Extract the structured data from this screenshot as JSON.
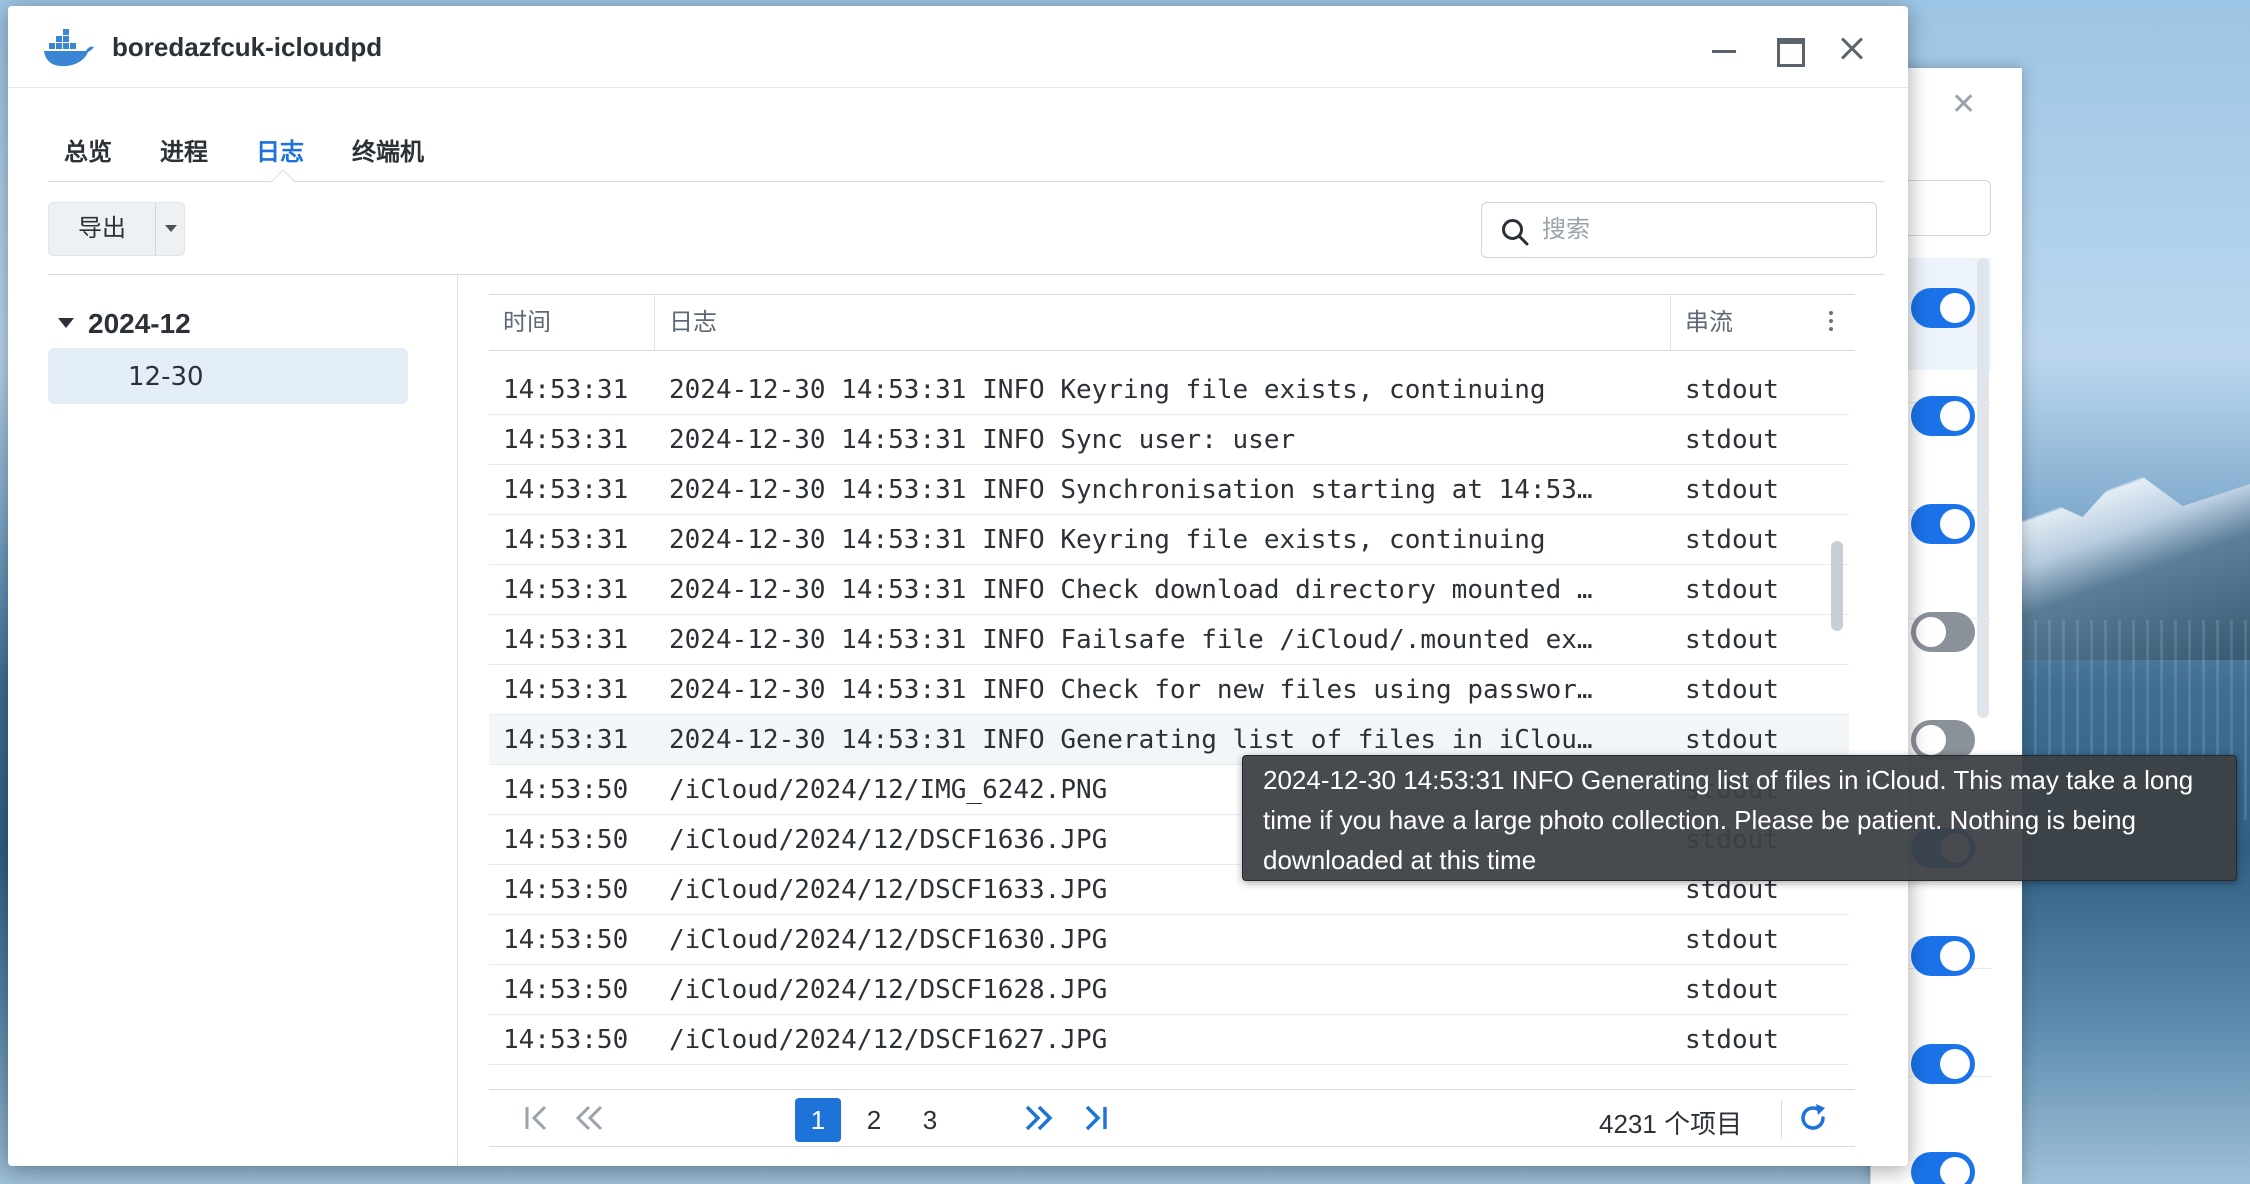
{
  "window": {
    "title": "boredazfcuk-icloudpd"
  },
  "tabs": [
    {
      "label": "总览",
      "active": false
    },
    {
      "label": "进程",
      "active": false
    },
    {
      "label": "日志",
      "active": true
    },
    {
      "label": "终端机",
      "active": false
    }
  ],
  "toolbar": {
    "export_label": "导出"
  },
  "search": {
    "placeholder": "搜索",
    "value": ""
  },
  "sidebar": {
    "group": "2024-12",
    "items": [
      {
        "label": "12-30",
        "selected": true
      }
    ]
  },
  "table": {
    "columns": {
      "time": "时间",
      "log": "日志",
      "stream": "串流"
    },
    "rows": [
      {
        "time": "14:53:31",
        "log": "2024-12-30 14:53:31 INFO    Keyring file exists, continuing",
        "stream": "stdout"
      },
      {
        "time": "14:53:31",
        "log": "2024-12-30 14:53:31 INFO    Sync user: user",
        "stream": "stdout"
      },
      {
        "time": "14:53:31",
        "log": "2024-12-30 14:53:31 INFO    Synchronisation starting at 14:53…",
        "stream": "stdout"
      },
      {
        "time": "14:53:31",
        "log": "2024-12-30 14:53:31 INFO    Keyring file exists, continuing",
        "stream": "stdout"
      },
      {
        "time": "14:53:31",
        "log": "2024-12-30 14:53:31 INFO    Check download directory mounted …",
        "stream": "stdout"
      },
      {
        "time": "14:53:31",
        "log": "2024-12-30 14:53:31 INFO    Failsafe file /iCloud/.mounted ex…",
        "stream": "stdout"
      },
      {
        "time": "14:53:31",
        "log": "2024-12-30 14:53:31 INFO    Check for new files using passwor…",
        "stream": "stdout"
      },
      {
        "time": "14:53:31",
        "log": "2024-12-30 14:53:31 INFO    Generating list of files in iClou…",
        "stream": "stdout"
      },
      {
        "time": "14:53:50",
        "log": "/iCloud/2024/12/IMG_6242.PNG",
        "stream": "stdout"
      },
      {
        "time": "14:53:50",
        "log": "/iCloud/2024/12/DSCF1636.JPG",
        "stream": "stdout"
      },
      {
        "time": "14:53:50",
        "log": "/iCloud/2024/12/DSCF1633.JPG",
        "stream": "stdout"
      },
      {
        "time": "14:53:50",
        "log": "/iCloud/2024/12/DSCF1630.JPG",
        "stream": "stdout"
      },
      {
        "time": "14:53:50",
        "log": "/iCloud/2024/12/DSCF1628.JPG",
        "stream": "stdout"
      },
      {
        "time": "14:53:50",
        "log": "/iCloud/2024/12/DSCF1627.JPG",
        "stream": "stdout"
      }
    ],
    "highlighted_row": 7
  },
  "pager": {
    "pages": [
      "1",
      "2",
      "3"
    ],
    "current": "1",
    "count_text": "4231 个项目"
  },
  "tooltip": {
    "text": "2024-12-30 14:53:31 INFO Generating list of files in iCloud. This may take a long time if you have a large photo collection. Please be patient. Nothing is being downloaded at this time"
  },
  "colors": {
    "accent": "#1d73d8",
    "toggle_on": "#1a73e8",
    "toggle_off": "#8b9199",
    "tooltip_bg": "#3c4044"
  },
  "icons": {
    "app": "docker-whale-icon",
    "search": "search-icon",
    "first": "first-page-icon",
    "prev": "previous-pages-icon",
    "next": "next-pages-icon",
    "last": "last-page-icon",
    "refresh": "refresh-icon"
  }
}
